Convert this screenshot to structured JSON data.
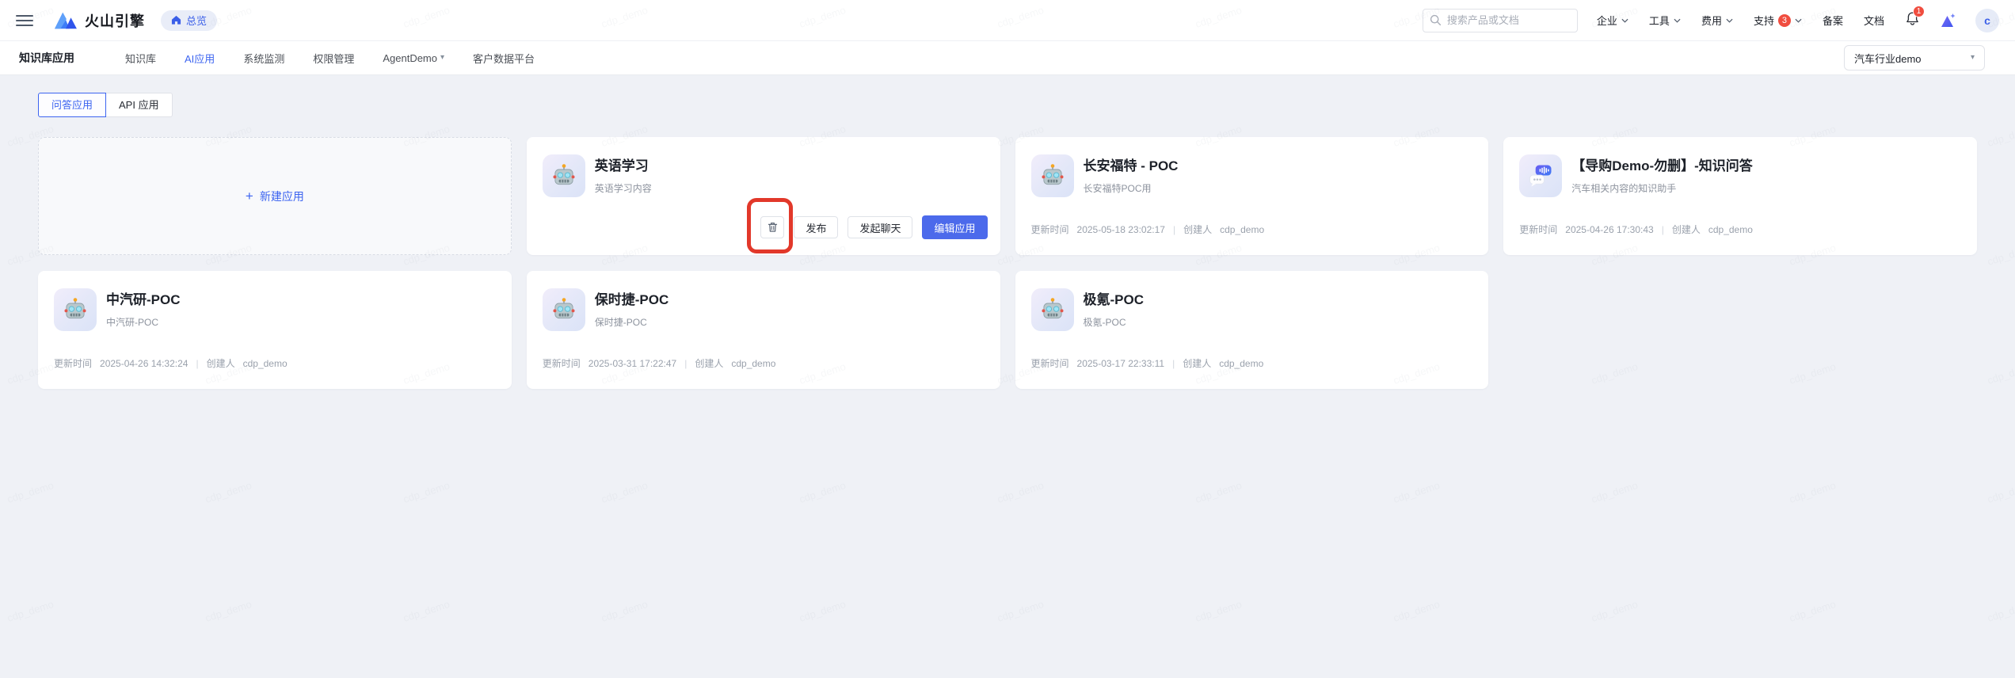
{
  "watermark": "cdp_demo",
  "colors": {
    "accent_blue": "#3c64f0",
    "primary_button_blue": "#4c6aeb",
    "annotation_red": "#e2382a",
    "badge_red": "#f04d3f",
    "page_background": "#eff1f6"
  },
  "topbar": {
    "brand": "火山引擎",
    "overview_label": "总览",
    "search_placeholder": "搜索产品或文档",
    "menu": [
      {
        "label": "企业",
        "caret": true
      },
      {
        "label": "工具",
        "caret": true
      },
      {
        "label": "费用",
        "caret": true
      },
      {
        "label": "支持",
        "caret": true,
        "badge": "3"
      },
      {
        "label": "备案"
      },
      {
        "label": "文档"
      }
    ],
    "bell_badge": "1",
    "avatar_letter": "c"
  },
  "nav": {
    "section": "知识库应用",
    "items": [
      {
        "label": "知识库"
      },
      {
        "label": "AI应用",
        "active": true
      },
      {
        "label": "系统监测"
      },
      {
        "label": "权限管理"
      },
      {
        "label": "AgentDemo",
        "caret": true
      },
      {
        "label": "客户数据平台"
      }
    ],
    "workspace_select": "汽车行业demo"
  },
  "tabs": [
    {
      "label": "问答应用",
      "active": true
    },
    {
      "label": "API 应用"
    }
  ],
  "new_app": {
    "plus": "+",
    "label": "新建应用"
  },
  "card_actions": {
    "publish": "发布",
    "start_chat": "发起聊天",
    "edit": "编辑应用"
  },
  "footer_labels": {
    "updated_prefix": "更新时间",
    "separator": "|",
    "creator_prefix": "创建人"
  },
  "cards": [
    {
      "title": "英语学习",
      "subtitle": "英语学习内容",
      "icon": "robot",
      "hover_actions": true,
      "annotated": true
    },
    {
      "title": "长安福特 - POC",
      "subtitle": "长安福特POC用",
      "icon": "robot",
      "updated": "2025-05-18 23:02:17",
      "creator": "cdp_demo"
    },
    {
      "title": "【导购Demo-勿删】-知识问答",
      "subtitle": "汽车相关内容的知识助手",
      "icon": "chat",
      "updated": "2025-04-26 17:30:43",
      "creator": "cdp_demo"
    },
    {
      "title": "中汽研-POC",
      "subtitle": "中汽研-POC",
      "icon": "robot",
      "updated": "2025-04-26 14:32:24",
      "creator": "cdp_demo"
    },
    {
      "title": "保时捷-POC",
      "subtitle": "保时捷-POC",
      "icon": "robot",
      "updated": "2025-03-31 17:22:47",
      "creator": "cdp_demo"
    },
    {
      "title": "极氪-POC",
      "subtitle": "极氪-POC",
      "icon": "robot",
      "updated": "2025-03-17 22:33:11",
      "creator": "cdp_demo"
    }
  ]
}
